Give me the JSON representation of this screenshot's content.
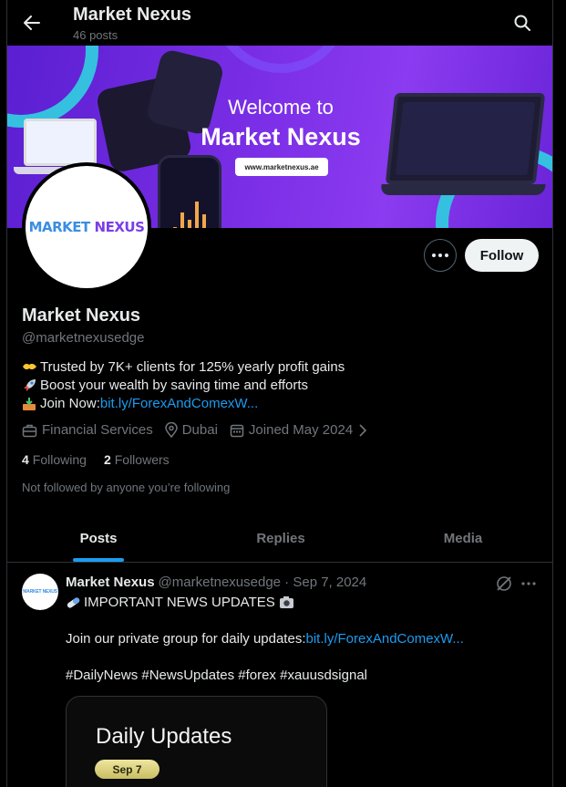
{
  "header": {
    "title": "Market Nexus",
    "post_count": "46 posts"
  },
  "banner": {
    "welcome": "Welcome to",
    "brand": "Market Nexus",
    "url": "www.marketnexus.ae"
  },
  "avatar": {
    "logo_text_1": "MARKET",
    "logo_text_2": "NEXUS"
  },
  "actions": {
    "follow_label": "Follow"
  },
  "profile": {
    "name": "Market Nexus",
    "handle": "@marketnexusedge",
    "bio": [
      {
        "icon": "handshake-emoji",
        "text": "Trusted by 7K+ clients for 125% yearly profit gains"
      },
      {
        "icon": "rocket-emoji",
        "text": "Boost your wealth by saving time and efforts"
      },
      {
        "icon": "inbox-tray-emoji",
        "text": "Join Now: ",
        "link": "bit.ly/ForexAndComexW..."
      }
    ],
    "category": "Financial Services",
    "location": "Dubai",
    "joined": "Joined May 2024",
    "following_count": "4",
    "following_label": "Following",
    "followers_count": "2",
    "followers_label": "Followers",
    "not_followed": "Not followed by anyone you’re following"
  },
  "tabs": [
    {
      "label": "Posts",
      "active": true
    },
    {
      "label": "Replies",
      "active": false
    },
    {
      "label": "Media",
      "active": false
    }
  ],
  "post": {
    "author": "Market Nexus",
    "meta": "@marketnexusedge · Sep 7, 2024",
    "line1": "IMPORTANT NEWS UPDATES",
    "line2_text": "Join our private group for daily updates: ",
    "line2_link": "bit.ly/ForexAndComexW...",
    "hashtags": "#DailyNews #NewsUpdates #forex #xauusdsignal",
    "media_title": "Daily Updates",
    "media_date": "Sep 7"
  },
  "colors": {
    "accent": "#1d9bf0",
    "background": "#000000",
    "muted": "#71767b",
    "banner_purple": "#7a2ee6",
    "banner_ring": "#35c0e0"
  }
}
